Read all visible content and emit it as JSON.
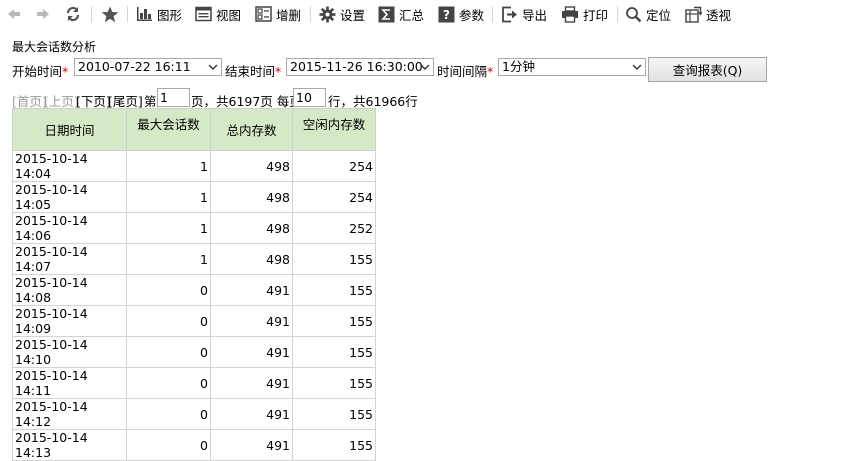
{
  "toolbar": {
    "graph_label": "图形",
    "view_label": "视图",
    "adddel_label": "增删",
    "settings_label": "设置",
    "summary_label": "汇总",
    "params_label": "参数",
    "export_label": "导出",
    "print_label": "打印",
    "locate_label": "定位",
    "pivot_label": "透视"
  },
  "report_title": "最大会话数分析",
  "filters": {
    "start_label": "开始时间",
    "start_value": "2010-07-22 16:11",
    "end_label": "结束时间",
    "end_value": "2015-11-26 16:30:00",
    "interval_label": "时间间隔",
    "interval_value": "1分钟",
    "required_mark": "*",
    "query_button": "查询报表(Q)"
  },
  "pager": {
    "first": "[首页]",
    "prev": "[上页]",
    "next": "[下页]",
    "last": "[尾页]",
    "page_prefix": "第",
    "page_value": "1",
    "page_suffix": "页，共6197页 每页",
    "per_page_value": "10",
    "per_page_suffix": "行，共61966行"
  },
  "table": {
    "headers": [
      "日期时间",
      "最大会话数",
      "总内存数",
      "空闲内存数"
    ],
    "rows": [
      [
        "2015-10-14 14:04",
        "1",
        "498",
        "254"
      ],
      [
        "2015-10-14 14:05",
        "1",
        "498",
        "254"
      ],
      [
        "2015-10-14 14:06",
        "1",
        "498",
        "252"
      ],
      [
        "2015-10-14 14:07",
        "1",
        "498",
        "155"
      ],
      [
        "2015-10-14 14:08",
        "0",
        "491",
        "155"
      ],
      [
        "2015-10-14 14:09",
        "0",
        "491",
        "155"
      ],
      [
        "2015-10-14 14:10",
        "0",
        "491",
        "155"
      ],
      [
        "2015-10-14 14:11",
        "0",
        "491",
        "155"
      ],
      [
        "2015-10-14 14:12",
        "0",
        "491",
        "155"
      ],
      [
        "2015-10-14 14:13",
        "0",
        "491",
        "155"
      ]
    ]
  }
}
